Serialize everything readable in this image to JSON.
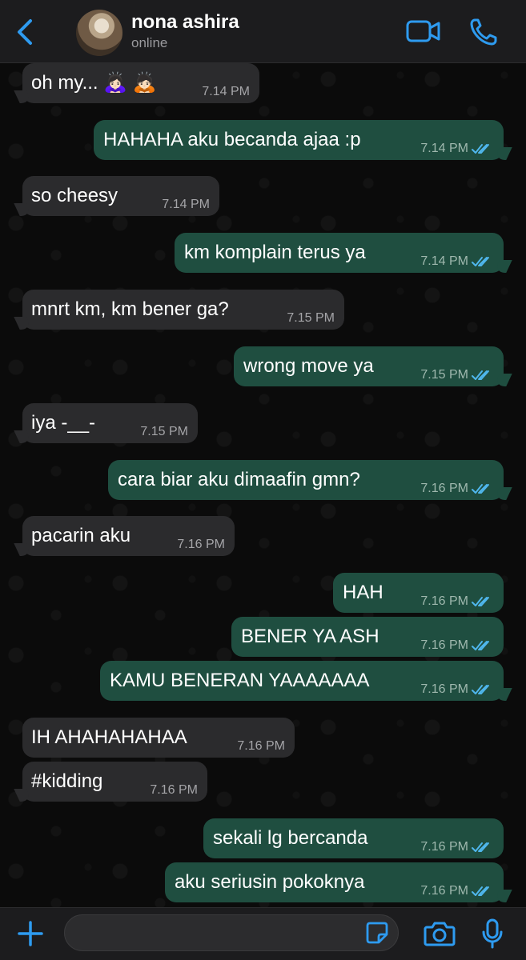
{
  "header": {
    "contact_name": "nona ashira",
    "status": "online",
    "accent_color": "#2e9bf0"
  },
  "messages": [
    {
      "dir": "in",
      "text": "oh my... 🙇🏻‍♀️ 🙇🏻",
      "time": "7.14 PM"
    },
    {
      "dir": "out",
      "text": "HAHAHA aku becanda ajaa :p",
      "time": "7.14 PM",
      "read": true
    },
    {
      "dir": "in",
      "text": "so cheesy",
      "time": "7.14 PM"
    },
    {
      "dir": "out",
      "text": "km komplain terus ya",
      "time": "7.14 PM",
      "read": true
    },
    {
      "dir": "in",
      "text": "mnrt km, km bener ga?",
      "time": "7.15 PM"
    },
    {
      "dir": "out",
      "text": "wrong move ya",
      "time": "7.15 PM",
      "read": true
    },
    {
      "dir": "in",
      "text": "iya -__-",
      "time": "7.15 PM"
    },
    {
      "dir": "out",
      "text": "cara biar aku dimaafin gmn?",
      "time": "7.16 PM",
      "read": true
    },
    {
      "dir": "in",
      "text": "pacarin aku",
      "time": "7.16 PM"
    },
    {
      "dir": "out",
      "text": "HAH",
      "time": "7.16 PM",
      "read": true
    },
    {
      "dir": "out",
      "text": "BENER YA ASH",
      "time": "7.16 PM",
      "read": true
    },
    {
      "dir": "out",
      "text": "KAMU BENERAN YAAAAAAA",
      "time": "7.16 PM",
      "read": true
    },
    {
      "dir": "in",
      "text": "IH AHAHAHAHAA",
      "time": "7.16 PM"
    },
    {
      "dir": "in",
      "text": "#kidding",
      "time": "7.16 PM"
    },
    {
      "dir": "out",
      "text": "sekali lg bercanda",
      "time": "7.16 PM",
      "read": true
    },
    {
      "dir": "out",
      "text": "aku seriusin pokoknya",
      "time": "7.16 PM",
      "read": true
    }
  ],
  "input": {
    "value": "",
    "placeholder": ""
  },
  "icons": {
    "back": "chevron-left-icon",
    "video": "video-camera-icon",
    "call": "phone-icon",
    "plus": "plus-icon",
    "sticker": "sticker-icon",
    "camera": "camera-icon",
    "mic": "microphone-icon"
  },
  "colors": {
    "incoming_bubble": "#2b2b2d",
    "outgoing_bubble": "#1f4e40",
    "read_ticks": "#4fb6ec"
  }
}
